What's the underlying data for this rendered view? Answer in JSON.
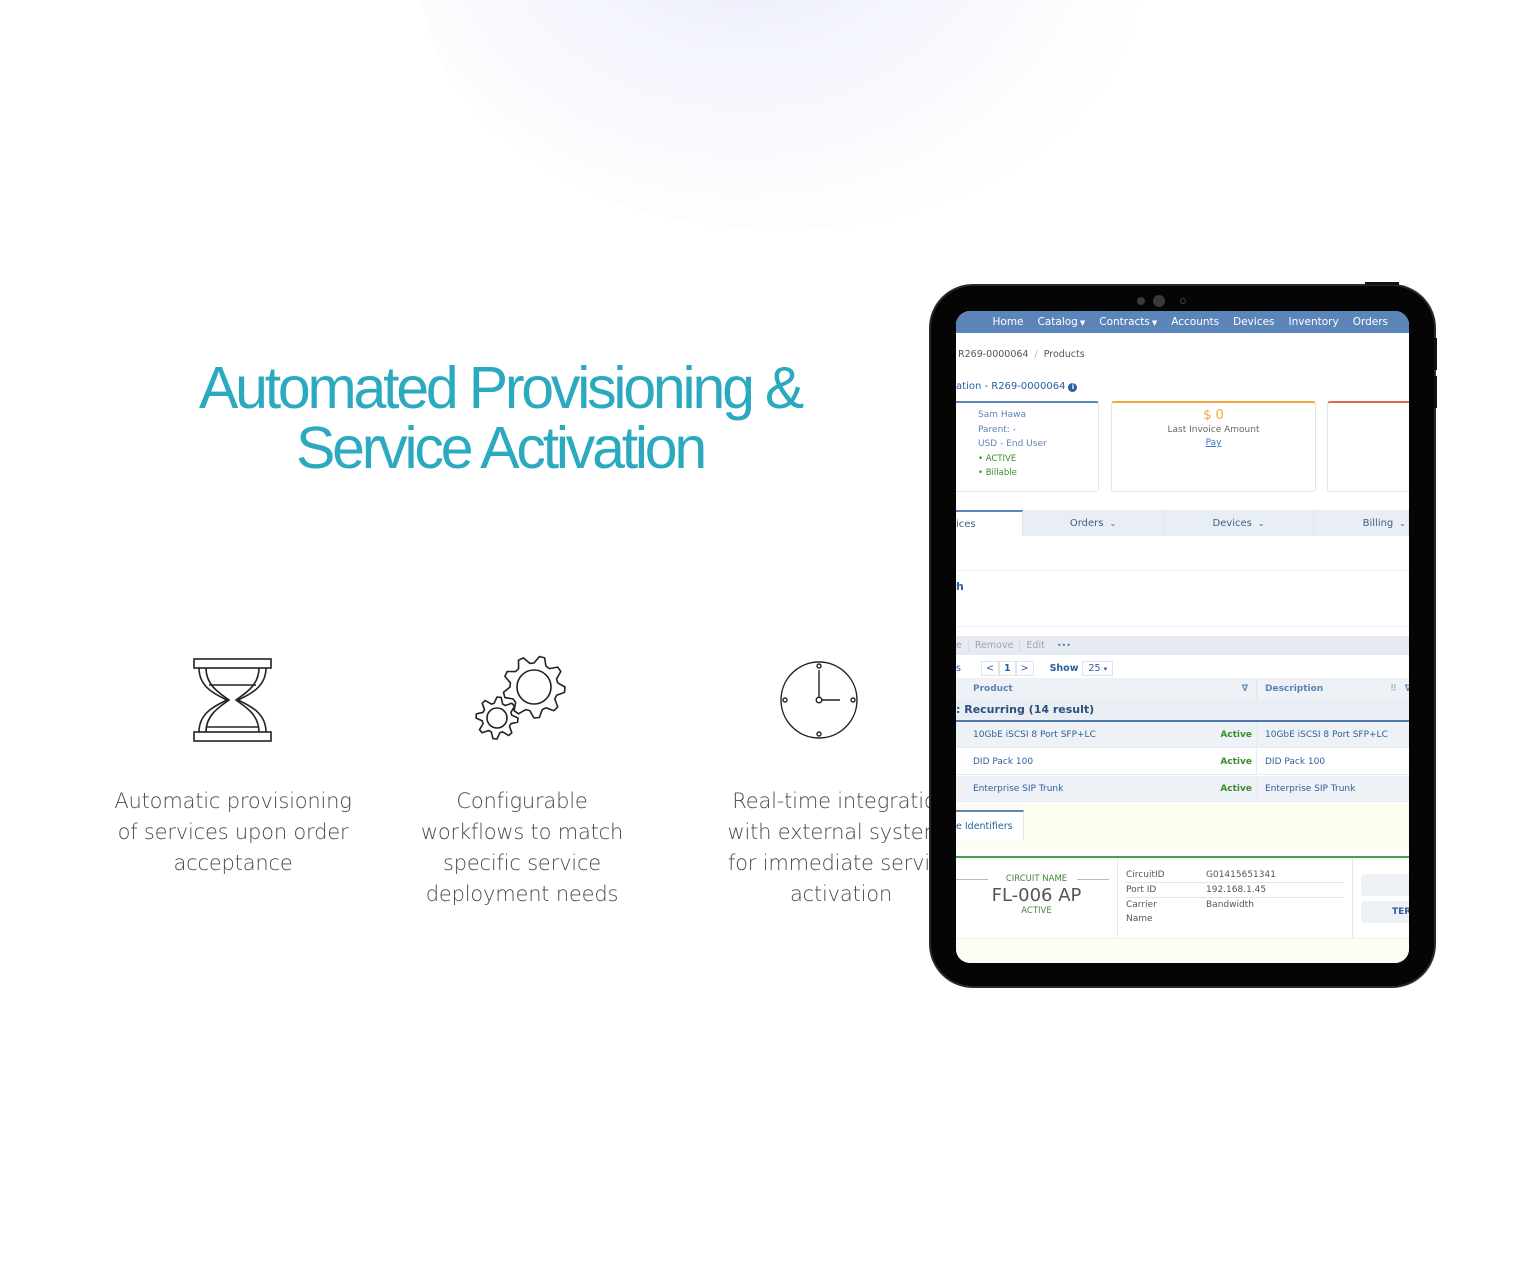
{
  "headline": {
    "line1": "Automated Provisioning &",
    "line2": "Service Activation",
    "color": "#2aa9bf"
  },
  "features": [
    {
      "icon": "hourglass-icon",
      "text": "Automatic provisioning of services upon order acceptance"
    },
    {
      "icon": "gears-icon",
      "text": "Configurable workflows to match specific service deployment needs"
    },
    {
      "icon": "clock-icon",
      "text": "Real-time integration with external systems for immediate service activation"
    }
  ],
  "app": {
    "nav": {
      "items": [
        {
          "label": "Home",
          "dropdown": false
        },
        {
          "label": "Catalog",
          "dropdown": true
        },
        {
          "label": "Contracts",
          "dropdown": true
        },
        {
          "label": "Accounts",
          "dropdown": false
        },
        {
          "label": "Devices",
          "dropdown": false
        },
        {
          "label": "Inventory",
          "dropdown": false
        },
        {
          "label": "Orders",
          "dropdown": false
        }
      ],
      "caret": "▼",
      "color": "#5b84b8"
    },
    "breadcrumb": {
      "account": "R269-0000064",
      "separator": "/",
      "current": "Products"
    },
    "account_title": "ation - R269-0000064",
    "info_icon": "i",
    "account_card": {
      "name": "Sam Hawa",
      "parent": "Parent: -",
      "currency_type": "USD - End User",
      "status": "• ACTIVE",
      "billable": "• Billable"
    },
    "invoice_card": {
      "amount": "$ 0",
      "label": "Last Invoice Amount",
      "link": "Pay"
    },
    "tabs": [
      {
        "label": "ices",
        "active": true,
        "chevron": ""
      },
      {
        "label": "Orders",
        "active": false,
        "chevron": "⌄"
      },
      {
        "label": "Devices",
        "active": false,
        "chevron": "⌄"
      },
      {
        "label": "Billing",
        "active": false,
        "chevron": "⌄"
      }
    ],
    "search_label": "h",
    "toolbar": {
      "items": [
        "e",
        "Remove",
        "Edit",
        "•••"
      ]
    },
    "pager": {
      "left": "s",
      "prev": "<",
      "page": "1",
      "next": ">",
      "show_label": "Show",
      "page_size": "25",
      "caret": "▾"
    },
    "table": {
      "columns": {
        "product": "Product",
        "description": "Description"
      },
      "filter_icon": "∇",
      "drag_icon": "⠿",
      "group_label": ": Recurring (14 result)",
      "rows": [
        {
          "product": "10GbE iSCSI 8 Port SFP+LC",
          "status": "Active",
          "description": "10GbE iSCSI 8 Port SFP+LC"
        },
        {
          "product": "DID Pack 100",
          "status": "Active",
          "description": "DID Pack 100"
        },
        {
          "product": "Enterprise SIP Trunk",
          "status": "Active",
          "description": "Enterprise SIP Trunk"
        }
      ]
    },
    "identifiers_tab": "e Identifiers",
    "circuit": {
      "title": "CIRCUIT NAME",
      "name": "FL-006 AP",
      "status": "ACTIVE",
      "fields": [
        {
          "key": "CircuitID",
          "value": "G01415651341"
        },
        {
          "key": "Port ID",
          "value": "192.168.1.45"
        },
        {
          "key": "Carrier Name",
          "value": "Bandwidth"
        }
      ],
      "button_partial": "TER"
    }
  }
}
